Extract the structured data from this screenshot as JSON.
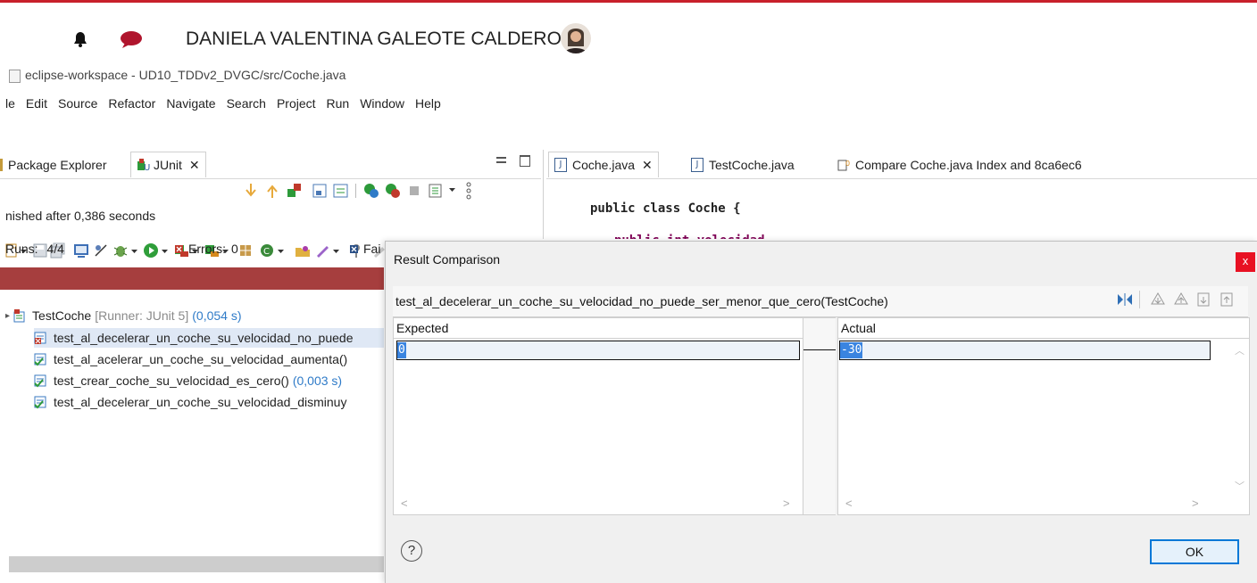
{
  "top_header": {
    "user_name": "DANIELA VALENTINA GALEOTE CALDERON",
    "icons": [
      "bell-icon",
      "chat-icon",
      "avatar"
    ],
    "accent_color": "#c8202b"
  },
  "window": {
    "title": "eclipse-workspace - UD10_TDDv2_DVGC/src/Coche.java"
  },
  "menu": [
    "le",
    "Edit",
    "Source",
    "Refactor",
    "Navigate",
    "Search",
    "Project",
    "Run",
    "Window",
    "Help"
  ],
  "left_panel": {
    "tabs": [
      {
        "label": "Package Explorer"
      },
      {
        "label": "JUnit"
      }
    ],
    "status": "nished after 0,386 seconds",
    "runs_label": "Runs:",
    "runs_value": "4/4",
    "errors_label": "Errors:",
    "errors_value": "0",
    "failures_label": "Fai",
    "progress_color": "#a63e3e",
    "tree": {
      "root_label": "TestCoche",
      "root_runner": "[Runner: JUnit 5]",
      "root_time": "(0,054 s)",
      "items": [
        {
          "label": "test_al_decelerar_un_coche_su_velocidad_no_puede",
          "time": "",
          "status": "failed"
        },
        {
          "label": "test_al_acelerar_un_coche_su_velocidad_aumenta()",
          "time": "",
          "status": "passed"
        },
        {
          "label": "test_crear_coche_su_velocidad_es_cero()",
          "time": "(0,003 s)",
          "status": "passed"
        },
        {
          "label": "test_al_decelerar_un_coche_su_velocidad_disminuy",
          "time": "",
          "status": "passed"
        }
      ]
    }
  },
  "editor": {
    "tabs": [
      {
        "label": "Coche.java"
      },
      {
        "label": "TestCoche.java"
      },
      {
        "label": "Compare Coche.java Index and 8ca6ec6"
      }
    ],
    "code_line": "public class Coche {"
  },
  "dialog": {
    "title": "Result Comparison",
    "close_label": "x",
    "test_name": "test_al_decelerar_un_coche_su_velocidad_no_puede_ser_menor_que_cero(TestCoche)",
    "expected_header": "Expected",
    "actual_header": "Actual",
    "expected_value": "0",
    "actual_value": "-30",
    "help_symbol": "?",
    "ok_label": "OK",
    "close_color": "#e81123"
  }
}
